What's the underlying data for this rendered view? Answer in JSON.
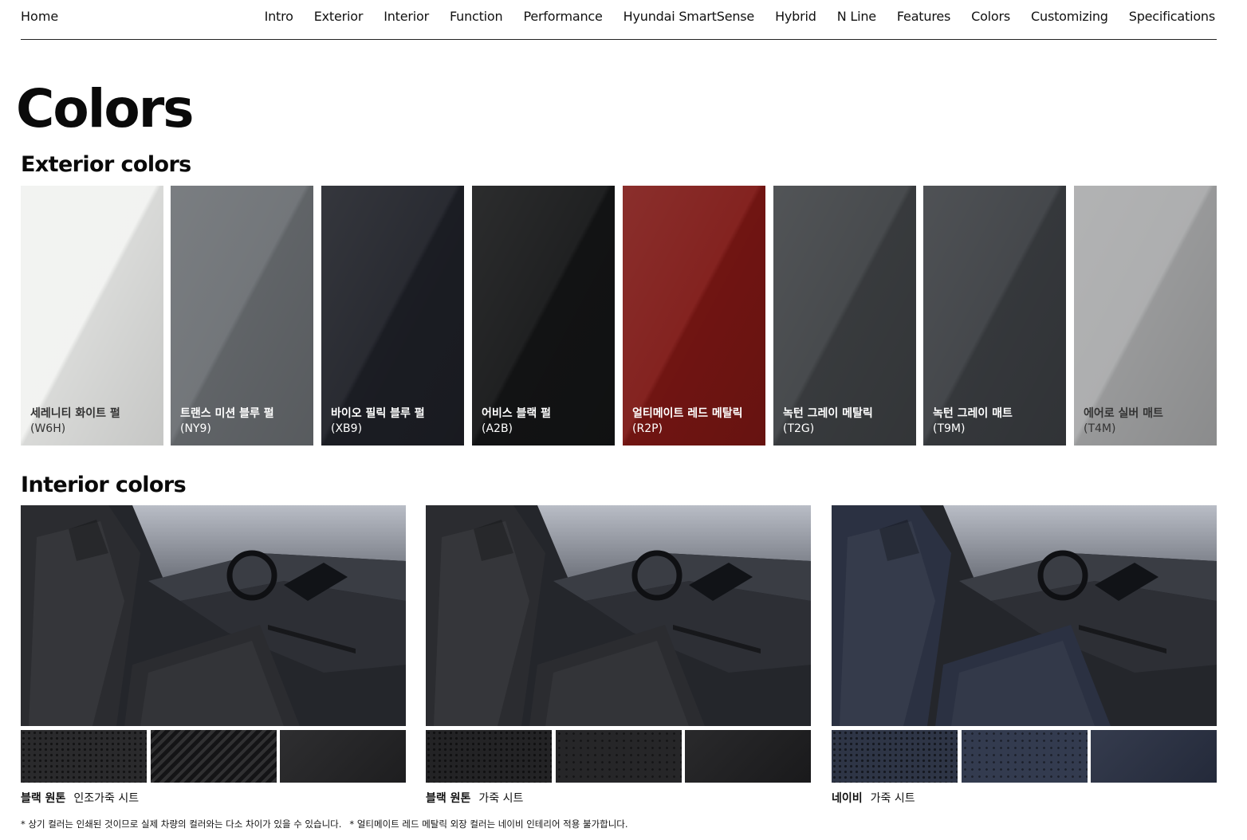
{
  "nav": {
    "home": "Home",
    "links": [
      "Intro",
      "Exterior",
      "Interior",
      "Function",
      "Performance",
      "Hyundai SmartSense",
      "Hybrid",
      "N Line",
      "Features",
      "Colors",
      "Customizing",
      "Specifications"
    ]
  },
  "page_title": "Colors",
  "exterior": {
    "title": "Exterior colors",
    "swatches": [
      {
        "name": "세레니티 화이트 펄",
        "code": "(W6H)",
        "color": "#f1f2f0",
        "text_color": "#333333"
      },
      {
        "name": "트랜스 미션 블루 펄",
        "code": "(NY9)",
        "color": "#6b6f73",
        "text_color": "#ffffff"
      },
      {
        "name": "바이오 필릭 블루 펄",
        "code": "(XB9)",
        "color": "#1e2027",
        "text_color": "#ffffff"
      },
      {
        "name": "어비스 블랙 펄",
        "code": "(A2B)",
        "color": "#141516",
        "text_color": "#ffffff"
      },
      {
        "name": "얼티메이트 레드 메탈릭",
        "code": "(R2P)",
        "color": "#7d1714",
        "text_color": "#ffffff"
      },
      {
        "name": "녹턴 그레이 메탈릭",
        "code": "(T2G)",
        "color": "#3e4144",
        "text_color": "#ffffff"
      },
      {
        "name": "녹턴 그레이 매트",
        "code": "(T9M)",
        "color": "#3b3e42",
        "text_color": "#ffffff"
      },
      {
        "name": "에어로 실버 매트",
        "code": "(T4M)",
        "color": "#a9aaab",
        "text_color": "#333333"
      }
    ]
  },
  "interior": {
    "title": "Interior colors",
    "options": [
      {
        "color_name": "블랙 원톤",
        "material": "인조가죽 시트",
        "seat_color": "#2b2c30",
        "materials": [
          {
            "color": "#2a2a2c",
            "texture": "perforated"
          },
          {
            "color": "#1f1f21",
            "texture": "diagonal"
          },
          {
            "color": "#232325",
            "texture": "plain"
          }
        ]
      },
      {
        "color_name": "블랙 원톤",
        "material": "가죽 시트",
        "seat_color": "#2b2c30",
        "materials": [
          {
            "color": "#232325",
            "texture": "perforated"
          },
          {
            "color": "#262628",
            "texture": "dotgrid"
          },
          {
            "color": "#1e1e20",
            "texture": "plain"
          }
        ]
      },
      {
        "color_name": "네이비",
        "material": "가죽 시트",
        "seat_color": "#2b3142",
        "materials": [
          {
            "color": "#2e3546",
            "texture": "perforated"
          },
          {
            "color": "#333b4f",
            "texture": "dotgrid"
          },
          {
            "color": "#2a3144",
            "texture": "plain"
          }
        ]
      }
    ]
  },
  "footnotes": [
    "* 상기 컬러는 인쇄된 것이므로 실제 차량의 컬러와는 다소 차이가 있을 수 있습니다.",
    "* 얼티메이트 레드 메탈릭 외장 컬러는 네이비 인테리어 적용 불가합니다."
  ]
}
